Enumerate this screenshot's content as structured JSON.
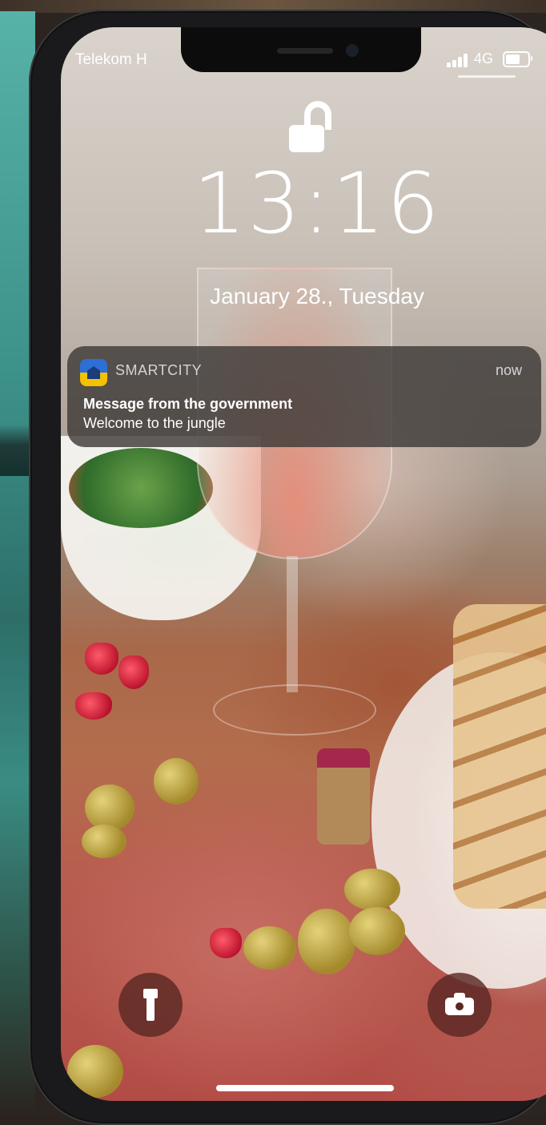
{
  "status_bar": {
    "carrier": "Telekom H",
    "network": "4G",
    "signal_bars": 4,
    "battery_level": 0.75
  },
  "lock_screen": {
    "time": "13:16",
    "date": "January 28., Tuesday"
  },
  "notification": {
    "app_name": "SMARTCITY",
    "time": "now",
    "title": "Message from the government",
    "body": "Welcome to the jungle"
  },
  "quick_actions": {
    "left_icon": "flashlight-icon",
    "right_icon": "camera-icon"
  },
  "colors": {
    "notification_bg": "#3e3a38",
    "quick_action_bg": "#5a2823",
    "app_icon_blue": "#2d6fd6",
    "app_icon_yellow": "#f3c200"
  }
}
